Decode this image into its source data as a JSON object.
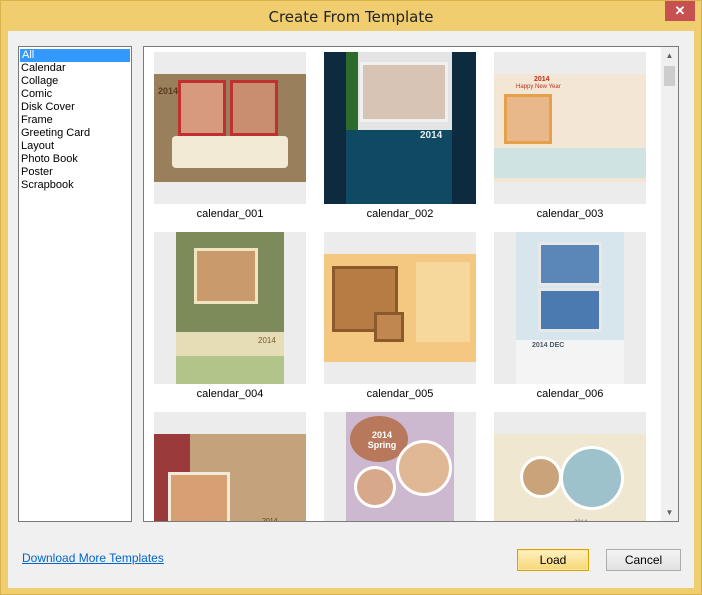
{
  "window": {
    "title": "Create From Template",
    "close_glyph": "✕"
  },
  "categories": [
    "All",
    "Calendar",
    "Collage",
    "Comic",
    "Disk Cover",
    "Frame",
    "Greeting Card",
    "Layout",
    "Photo Book",
    "Poster",
    "Scrapbook"
  ],
  "selected_category": "All",
  "templates": [
    {
      "name": "calendar_001",
      "year": "2014"
    },
    {
      "name": "calendar_002",
      "year": "2014"
    },
    {
      "name": "calendar_003",
      "year": "2014",
      "banner": "Happy New Year"
    },
    {
      "name": "calendar_004",
      "year": "2014"
    },
    {
      "name": "calendar_005",
      "year": ""
    },
    {
      "name": "calendar_006",
      "year": "2014 DEC"
    },
    {
      "name": "",
      "year": "2014"
    },
    {
      "name": "",
      "year": "2014 Spring"
    },
    {
      "name": "",
      "year": "2014"
    }
  ],
  "footer": {
    "link_label": "Download More Templates",
    "load_label": "Load",
    "cancel_label": "Cancel"
  },
  "icons": {
    "scroll_up": "▲",
    "scroll_down": "▼"
  }
}
